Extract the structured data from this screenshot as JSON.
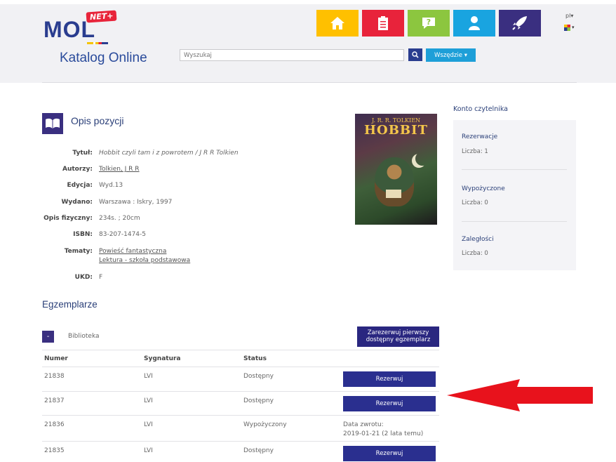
{
  "header": {
    "logo_text": "MOL",
    "logo_badge": "NET+",
    "title": "Katalog Online",
    "language": "pl",
    "search_placeholder": "Wyszukaj",
    "scope_label": "Wszędzie",
    "nav": [
      {
        "name": "home",
        "color": "#ffc000"
      },
      {
        "name": "clipboard",
        "color": "#e8233b"
      },
      {
        "name": "help",
        "color": "#8cc63f"
      },
      {
        "name": "user",
        "color": "#19a4e0"
      },
      {
        "name": "rocket",
        "color": "#3a2f80"
      }
    ]
  },
  "item": {
    "section_title": "Opis pozycji",
    "fields": [
      {
        "label": "Tytuł:",
        "value": "Hobbit czyli tam i z powrotem / J R R Tolkien"
      },
      {
        "label": "Autorzy:",
        "value": "Tolkien, J R R"
      },
      {
        "label": "Edycja:",
        "value": "Wyd.13"
      },
      {
        "label": "Wydano:",
        "value": "Warszawa : Iskry, 1997"
      },
      {
        "label": "Opis fizyczny:",
        "value": "234s. ; 20cm"
      },
      {
        "label": "ISBN:",
        "value": "83-207-1474-5"
      },
      {
        "label": "Tematy:",
        "value": "Powieść fantastyczna",
        "value2": "Lektura - szkoła podstawowa"
      },
      {
        "label": "UKD:",
        "value": "F"
      }
    ],
    "cover_author": "J. R. R. TOLKIEN",
    "cover_title": "HOBBIT"
  },
  "sidebar": {
    "title": "Konto czytelnika",
    "sections": [
      {
        "heading": "Rezerwacje",
        "value": "Liczba: 1"
      },
      {
        "heading": "Wypożyczone",
        "value": "Liczba: 0"
      },
      {
        "heading": "Zaległości",
        "value": "Liczba: 0"
      }
    ]
  },
  "copies": {
    "title": "Egzemplarze",
    "toggle": "-",
    "library": "Biblioteka",
    "reserve_first_line1": "Zarezerwuj pierwszy",
    "reserve_first_line2": "dostępny egzemplarz",
    "headers": [
      "Numer",
      "Sygnatura",
      "Status"
    ],
    "rows": [
      {
        "numer": "21838",
        "sygnatura": "LVI",
        "status": "Dostępny",
        "action": "Rezerwuj"
      },
      {
        "numer": "21837",
        "sygnatura": "LVI",
        "status": "Dostępny",
        "action": "Rezerwuj"
      },
      {
        "numer": "21836",
        "sygnatura": "LVI",
        "status": "Wypożyczony",
        "return_label": "Data zwrotu:",
        "return_date": "2019-01-21 (2 lata temu)"
      },
      {
        "numer": "21835",
        "sygnatura": "LVI",
        "status": "Dostępny",
        "action": "Rezerwuj"
      }
    ]
  },
  "annotation": {
    "arrow_color": "#e8121c"
  }
}
